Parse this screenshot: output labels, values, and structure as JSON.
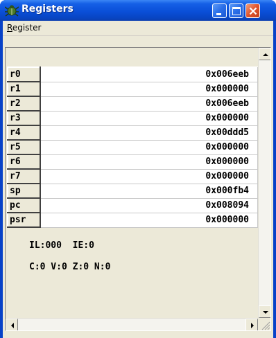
{
  "window": {
    "title": "Registers"
  },
  "menu": {
    "register_label_first": "R",
    "register_label_rest": "egister"
  },
  "registers": [
    {
      "name": "r0",
      "value": "0x006eeb"
    },
    {
      "name": "r1",
      "value": "0x000000"
    },
    {
      "name": "r2",
      "value": "0x006eeb"
    },
    {
      "name": "r3",
      "value": "0x000000"
    },
    {
      "name": "r4",
      "value": "0x00ddd5"
    },
    {
      "name": "r5",
      "value": "0x000000"
    },
    {
      "name": "r6",
      "value": "0x000000"
    },
    {
      "name": "r7",
      "value": "0x000000"
    },
    {
      "name": "sp",
      "value": "0x000fb4"
    },
    {
      "name": "pc",
      "value": "0x008094"
    },
    {
      "name": "psr",
      "value": "0x000000"
    }
  ],
  "status": {
    "line1": "IL:000  IE:0",
    "line2": "C:0 V:0 Z:0 N:0"
  },
  "icons": {
    "app": "bug-icon",
    "minimize": "minimize-icon",
    "maximize": "maximize-icon",
    "close": "close-icon"
  },
  "colors": {
    "titlebar": "#0a4fd8",
    "face": "#ece9d8",
    "close_button": "#e0542c"
  }
}
